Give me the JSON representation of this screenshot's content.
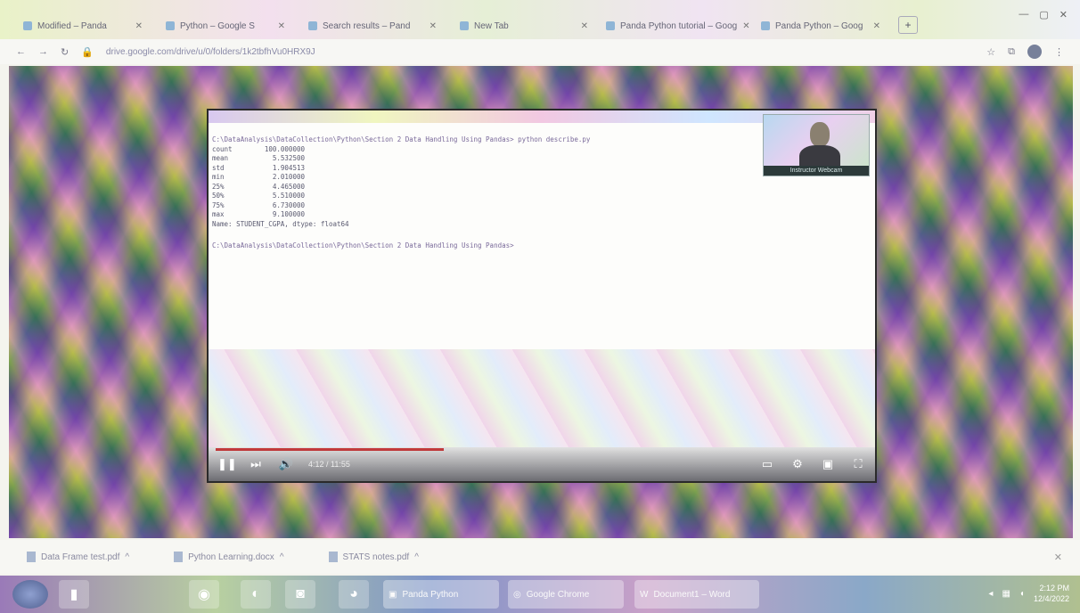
{
  "tabs": [
    {
      "label": "Modified – Panda"
    },
    {
      "label": "Python – Google S"
    },
    {
      "label": "Search results – Pand"
    },
    {
      "label": "New Tab"
    },
    {
      "label": "Panda Python tutorial – Goog"
    },
    {
      "label": "Panda Python – Goog"
    }
  ],
  "address": {
    "url": "drive.google.com/drive/u/0/folders/1k2tbfhVu0HRX9J"
  },
  "terminal": {
    "command": "C:\\DataAnalysis\\DataCollection\\Python\\Section 2 Data Handling Using Pandas> python describe.py",
    "rows": [
      {
        "k": "count",
        "v": "100.000000"
      },
      {
        "k": "mean",
        "v": "5.532500"
      },
      {
        "k": "std",
        "v": "1.904513"
      },
      {
        "k": "min",
        "v": "2.010000"
      },
      {
        "k": "25%",
        "v": "4.465000"
      },
      {
        "k": "50%",
        "v": "5.510000"
      },
      {
        "k": "75%",
        "v": "6.730000"
      },
      {
        "k": "max",
        "v": "9.100000"
      }
    ],
    "footer": "Name: STUDENT_CGPA, dtype: float64",
    "prompt": "C:\\DataAnalysis\\DataCollection\\Python\\Section 2 Data Handling Using Pandas>"
  },
  "webcam": {
    "caption": "Instructor Webcam"
  },
  "player": {
    "time": "4:12 / 11:55",
    "progress_fraction": 0.35
  },
  "downloads": [
    {
      "label": "Data Frame test.pdf"
    },
    {
      "label": "Python Learning.docx"
    },
    {
      "label": "STATS notes.pdf"
    }
  ],
  "taskbar": {
    "apps": [
      {
        "label": "Panda Python"
      },
      {
        "label": "Google Chrome"
      },
      {
        "label": "Document1 – Word"
      }
    ],
    "time": "2:12 PM",
    "date": "12/4/2022"
  },
  "icons": [
    "back-icon",
    "forward-icon",
    "reload-icon",
    "lock-icon",
    "star-icon",
    "play-icon",
    "volume-icon",
    "subtitles-icon",
    "settings-icon",
    "fullscreen-icon",
    "file-icon"
  ]
}
